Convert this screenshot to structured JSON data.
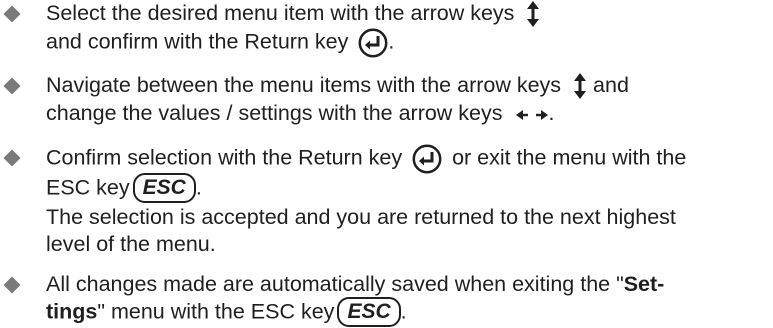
{
  "items": [
    {
      "lines": [
        {
          "pre": "Select the desired menu item with the arrow keys"
        },
        {
          "pre": "and confirm with the Return key",
          "post": "."
        }
      ]
    },
    {
      "lines": [
        {
          "pre": "Navigate between the menu items with the arrow keys",
          "post": "and"
        },
        {
          "pre": "change the values / settings with the arrow keys",
          "post": "."
        }
      ]
    },
    {
      "lines": [
        {
          "pre": "Confirm selection with the Return key",
          "post": "or exit the menu with the"
        },
        {
          "pre": "ESC key",
          "key": "ESC",
          "post": "."
        }
      ],
      "sub_lines": [
        "The selection is accepted and you are returned to the next highest",
        "level of the menu."
      ]
    },
    {
      "lines": [
        {
          "pre": "All changes made are automatically saved when exiting the \"",
          "bold": "Set-"
        },
        {
          "bold": "tings",
          "mid": "\" menu with the ESC key",
          "key": "ESC",
          "post": "."
        }
      ]
    }
  ],
  "icons": {
    "up_down_arrows": "up-down-arrows-icon",
    "left_right_arrows": "left-right-arrows-icon",
    "return_key": "return-key-icon",
    "bullet": "diamond-bullet-icon"
  }
}
